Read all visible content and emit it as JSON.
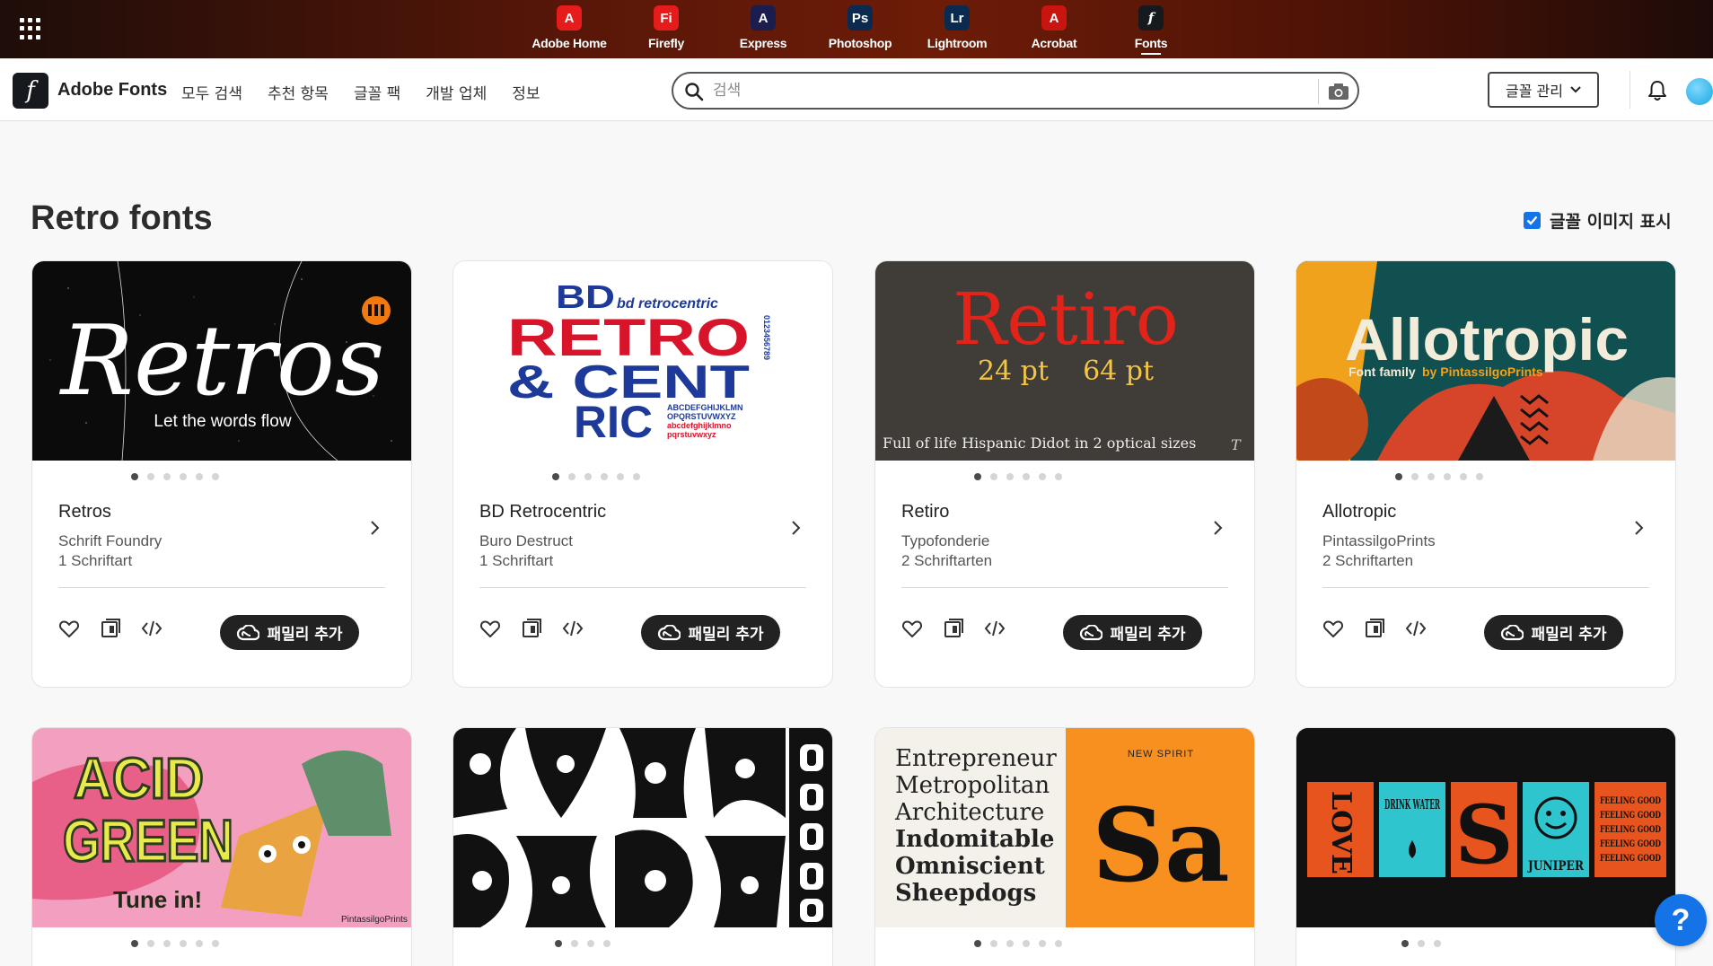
{
  "app_bar": {
    "apps": [
      {
        "label": "Adobe Home",
        "glyph": "A",
        "color": "#e61b1b",
        "active": false
      },
      {
        "label": "Firefly",
        "glyph": "Fi",
        "color": "#e61b1b",
        "active": false
      },
      {
        "label": "Express",
        "glyph": "A",
        "color": "#1b1d4e",
        "active": false
      },
      {
        "label": "Photoshop",
        "glyph": "Ps",
        "color": "#0a2a4f",
        "active": false
      },
      {
        "label": "Lightroom",
        "glyph": "Lr",
        "color": "#0a2a4f",
        "active": false
      },
      {
        "label": "Acrobat",
        "glyph": "A",
        "color": "#c8150f",
        "active": false
      },
      {
        "label": "Fonts",
        "glyph": "f",
        "color": "#161a1e",
        "active": true
      }
    ]
  },
  "nav": {
    "logo_glyph": "f",
    "brand": "Adobe Fonts",
    "links": [
      "모두 검색",
      "추천 항목",
      "글꼴 팩",
      "개발 업체",
      "정보"
    ],
    "search_placeholder": "검색",
    "search_value": "",
    "manage_label": "글꼴 관리"
  },
  "page": {
    "title": "Retro fonts",
    "show_images_label": "글꼴 이미지 표시",
    "show_images_checked": true
  },
  "cards": [
    {
      "name": "Retros",
      "foundry": "Schrift Foundry",
      "count": "1 Schriftart",
      "add_label": "패밀리 추가",
      "dots": 6,
      "active_dot": 0,
      "preview": {
        "main": "Retros",
        "sub": "Let the words flow"
      }
    },
    {
      "name": "BD Retrocentric",
      "foundry": "Buro Destruct",
      "count": "1 Schriftart",
      "add_label": "패밀리 추가",
      "dots": 6,
      "active_dot": 0,
      "preview": {
        "l1": "BD",
        "l1b": "bd retrocentric",
        "l2": "RETRO",
        "l3": "& CENT",
        "l4": "RIC",
        "alpha1": "ABCDEFGHIJKLMN",
        "alpha2": "OPQRSTUVWXYZ",
        "alpha3": "abcdefghijklmno",
        "alpha4": "pqrstuvwxyz",
        "vert": "0123456789"
      }
    },
    {
      "name": "Retiro",
      "foundry": "Typofonderie",
      "count": "2 Schriftarten",
      "add_label": "패밀리 추가",
      "dots": 6,
      "active_dot": 0,
      "preview": {
        "main": "Retiro",
        "sizes": "24 pt    64 pt",
        "tag": "Full of life Hispanic Didot in 2 optical sizes"
      }
    },
    {
      "name": "Allotropic",
      "foundry": "PintassilgoPrints",
      "count": "2 Schriftarten",
      "add_label": "패밀리 추가",
      "dots": 6,
      "active_dot": 0,
      "preview": {
        "main": "Allotropic",
        "sub1": "Font family",
        "sub2": "by PintassilgoPrints"
      }
    },
    {
      "dots": 6,
      "active_dot": 0,
      "preview": {
        "l1": "ACID",
        "l2": "GREEN",
        "l3": "Tune in!",
        "credit": "PintassilgoPrints"
      }
    },
    {
      "dots": 4,
      "active_dot": 0,
      "preview": {}
    },
    {
      "dots": 6,
      "active_dot": 0,
      "preview": {
        "words": [
          "Entrepreneur",
          "Metropolitan",
          "Architecture",
          "Indomitable",
          "Omniscient",
          "Sheepdogs"
        ],
        "tag": "NEW SPIRIT",
        "big": "Sa"
      }
    },
    {
      "dots": 3,
      "active_dot": 0,
      "preview": {
        "t1": "LOVE",
        "t2": "DRINK WATER",
        "t3": "S",
        "t4": "JUNIPER",
        "t5": "FEELING GOOD"
      }
    }
  ],
  "help_label": "?"
}
